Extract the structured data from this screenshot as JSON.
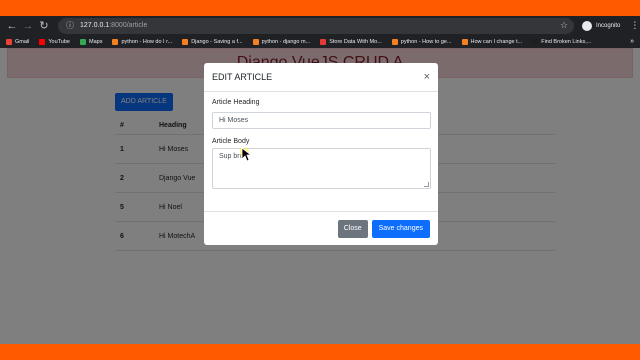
{
  "browser": {
    "url_host": "127.0.0.1",
    "url_path": ":8000/article",
    "profile_label": "Incognito",
    "bookmarks": [
      {
        "label": "Gmail",
        "color": "#ea4335"
      },
      {
        "label": "YouTube",
        "color": "#ff0000"
      },
      {
        "label": "Maps",
        "color": "#34a853"
      },
      {
        "label": "python - How do I r...",
        "color": "#f48024"
      },
      {
        "label": "Django - Saving a f...",
        "color": "#f48024"
      },
      {
        "label": "python - django m...",
        "color": "#f48024"
      },
      {
        "label": "Store Data With Mo...",
        "color": "#e53935"
      },
      {
        "label": "python - How to ge...",
        "color": "#f48024"
      },
      {
        "label": "How can I change t...",
        "color": "#f48024"
      },
      {
        "label": "Find Broken Links,...",
        "color": "#1e1e1e"
      }
    ]
  },
  "page": {
    "jumbo_title": "Django VueJS CRUD A",
    "add_button": "ADD ARTICLE",
    "table": {
      "headers": [
        "#",
        "Heading"
      ],
      "rows": [
        {
          "id": "1",
          "heading": "Hi Moses"
        },
        {
          "id": "2",
          "heading": "Django Vue"
        },
        {
          "id": "5",
          "heading": "Hi Noel"
        },
        {
          "id": "6",
          "heading": "Hi MotechA"
        }
      ]
    }
  },
  "modal": {
    "title": "EDIT ARTICLE",
    "heading_label": "Article Heading",
    "heading_value": "Hi Moses",
    "body_label": "Article Body",
    "body_value": "Sup bro",
    "close_button": "Close",
    "save_button": "Save changes"
  }
}
